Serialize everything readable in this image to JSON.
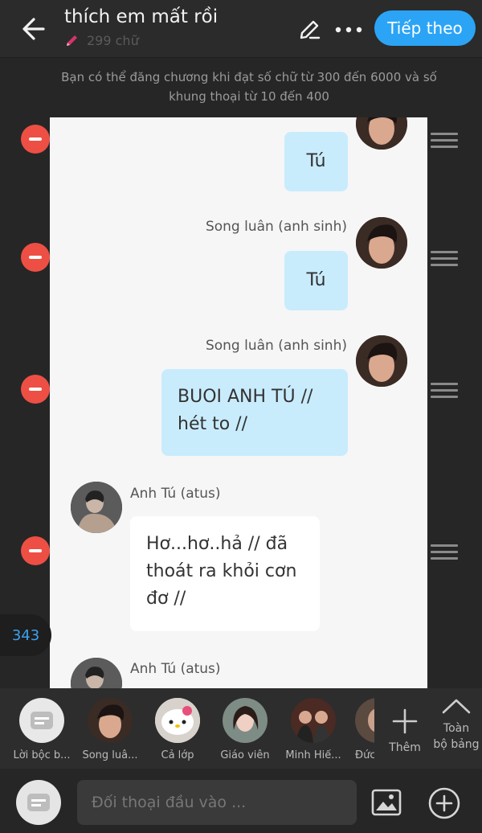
{
  "header": {
    "title": "thích em mất rồi",
    "word_count": "299 chữ",
    "next_label": "Tiếp theo"
  },
  "notice": "Bạn có thể đăng chương khi đạt số chữ từ 300 đến 6000 và số khung thoại từ 10 đến 400",
  "messages": [
    {
      "speaker": "",
      "text": "Tú"
    },
    {
      "speaker": "Song luân (anh sinh)",
      "text": "Tú"
    },
    {
      "speaker": "Song luân (anh sinh)",
      "text_lines": [
        "BUOI ANH TÚ //",
        "hét to //"
      ]
    },
    {
      "speaker": "Anh Tú (atus)",
      "text_lines": [
        "Hơ...hơ..hả // đã",
        "thoát ra khỏi cơn",
        "đơ //"
      ]
    },
    {
      "speaker": "Anh Tú (atus)",
      "text": ""
    }
  ],
  "counter": "343",
  "characters": [
    {
      "label": "Lời bộc b..."
    },
    {
      "label": "Song luâ..."
    },
    {
      "label": "Cả lớp"
    },
    {
      "label": "Giáo viên"
    },
    {
      "label": "Minh Hiế..."
    },
    {
      "label": "Đức"
    }
  ],
  "add_character_label": "Thêm",
  "whole_board_label": [
    "Toàn",
    "bộ bảng"
  ],
  "input": {
    "placeholder": "Đối thoại đầu vào ..."
  },
  "colors": {
    "accent": "#2ba4f5",
    "delete": "#ee4f44",
    "bubble_right": "#c9ecfd"
  }
}
